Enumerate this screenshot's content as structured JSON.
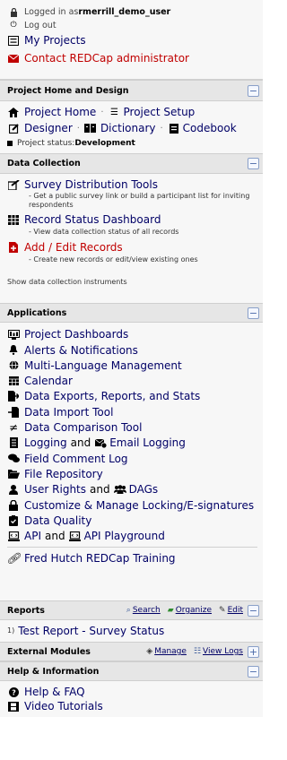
{
  "user": {
    "logged_prefix": "Logged in as ",
    "username": "rmerrill_demo_user",
    "logout": "Log out",
    "my_projects": "My Projects",
    "contact_admin": "Contact REDCap administrator"
  },
  "project_home": {
    "title": "Project Home and Design",
    "project_home": "Project Home",
    "project_setup": "Project Setup",
    "designer": "Designer",
    "dictionary": "Dictionary",
    "codebook": "Codebook",
    "status_label": "Project status: ",
    "status_value": "Development"
  },
  "data_collection": {
    "title": "Data Collection",
    "survey_tools": "Survey Distribution Tools",
    "survey_desc": "- Get a public survey link or build a participant list for inviting respondents",
    "record_status": "Record Status Dashboard",
    "record_status_desc": "- View data collection status of all records",
    "add_edit": "Add / Edit Records",
    "add_edit_desc": "- Create new records or edit/view existing ones",
    "show_instruments": "Show data collection instruments"
  },
  "applications": {
    "title": "Applications",
    "items": {
      "dashboards": "Project Dashboards",
      "alerts": "Alerts & Notifications",
      "multilang": "Multi-Language Management",
      "calendar": "Calendar",
      "exports": "Data Exports, Reports, and Stats",
      "import": "Data Import Tool",
      "comparison": "Data Comparison Tool",
      "logging": "Logging",
      "and1": "and",
      "email_logging": "Email Logging",
      "field_comment": "Field Comment Log",
      "file_repo": "File Repository",
      "user_rights": "User Rights",
      "and2": "and",
      "dags": "DAGs",
      "locking": "Customize & Manage Locking/E-signatures",
      "data_quality": "Data Quality",
      "api": "API",
      "and3": "and",
      "api_playground": "API Playground",
      "training": "Fred Hutch REDCap Training"
    }
  },
  "reports": {
    "title": "Reports",
    "search": "Search",
    "organize": "Organize",
    "edit": "Edit",
    "item_num": "1)",
    "item": "Test Report - Survey Status"
  },
  "external_modules": {
    "title": "External Modules",
    "manage": "Manage",
    "view_logs": "View Logs"
  },
  "help": {
    "title": "Help & Information",
    "faq": "Help & FAQ",
    "videos": "Video Tutorials"
  },
  "colors": {
    "link": "#000066",
    "red": "#c00000",
    "header_bg": "#e6e6e6",
    "body_bg": "#f7f7f7"
  }
}
